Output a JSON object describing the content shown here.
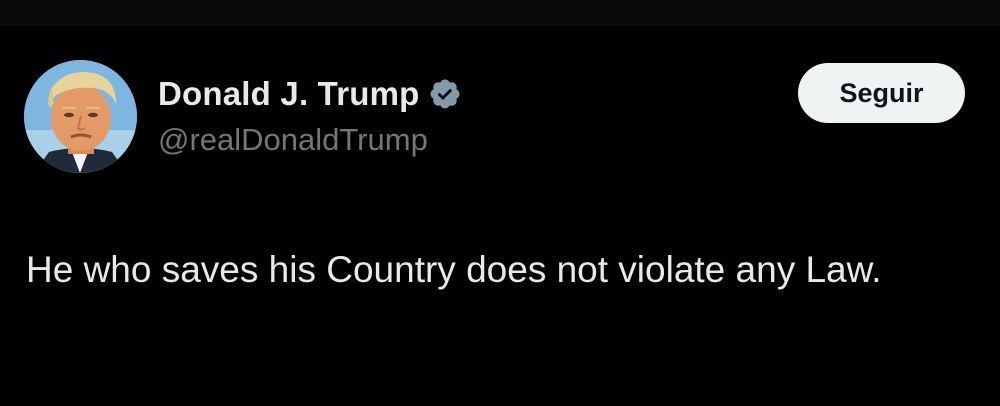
{
  "author": {
    "display_name": "Donald J. Trump",
    "handle": "@realDonaldTrump",
    "verified": true
  },
  "follow_button": {
    "label": "Seguir"
  },
  "tweet": {
    "text": "He who saves his Country does not violate any Law."
  },
  "icons": {
    "verified": "verified-badge-icon",
    "avatar": "profile-photo"
  },
  "colors": {
    "background": "#000000",
    "primary_text": "#e7e9ea",
    "secondary_text": "#71767b",
    "verified_badge": "#829aab",
    "button_bg": "#eff3f4",
    "button_text": "#0f1419"
  }
}
